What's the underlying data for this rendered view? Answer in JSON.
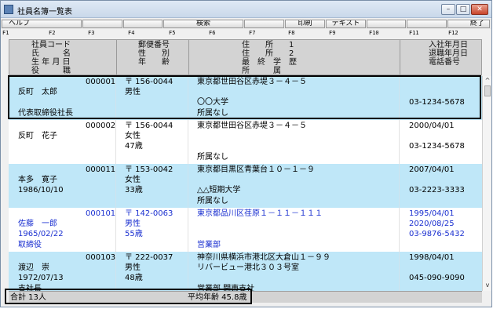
{
  "window": {
    "title": "社員名簿一覧表",
    "min_glyph": "–",
    "max_glyph": "□",
    "close_glyph": "✕"
  },
  "fkeys": {
    "help": "ヘルプ",
    "search": "検索",
    "print": "印刷",
    "text": "テキスト",
    "exit": "終了",
    "labels": [
      "F1",
      "F2",
      "F3",
      "F4",
      "F5",
      "F6",
      "F7",
      "F8",
      "F9",
      "F10",
      "F11",
      "F12"
    ]
  },
  "header": {
    "col1": [
      "社員コード",
      "氏　　　名",
      "生 年 月 日",
      "役　　　職"
    ],
    "col2": [
      "郵便番号",
      "性　　別",
      "年　　齢"
    ],
    "col3": [
      "住　　所　　1",
      "住　　所　　2",
      "最　終　学　歴",
      "所　　　属"
    ],
    "col4": [
      "入社年月日",
      "退職年月日",
      "電話番号"
    ]
  },
  "records": [
    {
      "code": "000001",
      "name": "反町　太郎",
      "birth": "",
      "role": "代表取締役社長",
      "zip": "〒 156-0044",
      "gender": "男性",
      "age": "",
      "addr1": "東京都世田谷区赤堤３－４－５",
      "addr2": "",
      "school": "〇〇大学",
      "dept": "所属なし",
      "joined": "",
      "retired": "",
      "phone": "03-1234-5678"
    },
    {
      "code": "000002",
      "name": "反町　花子",
      "birth": "",
      "role": "",
      "zip": "〒 156-0044",
      "gender": "女性",
      "age": "47歳",
      "addr1": "東京都世田谷区赤堤３－４－５",
      "addr2": "",
      "school": "",
      "dept": "所属なし",
      "joined": "2000/04/01",
      "retired": "",
      "phone": "03-1234-5678"
    },
    {
      "code": "000011",
      "name": "本多　寛子",
      "birth": "1986/10/10",
      "role": "",
      "zip": "〒 153-0042",
      "gender": "女性",
      "age": "33歳",
      "addr1": "東京都目黒区青葉台１０－１－９",
      "addr2": "",
      "school": "△△短期大学",
      "dept": "所属なし",
      "joined": "2007/04/01",
      "retired": "",
      "phone": "03-2223-3333"
    },
    {
      "code": "000101",
      "name": "佐藤　一郎",
      "birth": "1965/02/22",
      "role": "取締役",
      "zip": "〒 142-0063",
      "gender": "男性",
      "age": "55歳",
      "addr1": "東京都品川区荏原１－１１－１１１",
      "addr2": "",
      "school": "",
      "dept": "営業部",
      "joined": "1995/04/01",
      "retired": "2020/08/25",
      "phone": "03-9876-5432"
    },
    {
      "code": "000103",
      "name": "渡辺　崇",
      "birth": "1972/07/13",
      "role": "支社長",
      "zip": "〒 222-0037",
      "gender": "男性",
      "age": "48歳",
      "addr1": "神奈川県横浜市港北区大倉山１－９９",
      "addr2": "リバービュー港北３０３号室",
      "school": "",
      "dept": "営業部 関東支社",
      "joined": "1998/04/01",
      "retired": "",
      "phone": "045-090-9090"
    }
  ],
  "footer": {
    "total": "合計 13人",
    "avg_age": "平均年齢 45.8歳"
  },
  "scroll": {
    "up": "^",
    "down": "v"
  }
}
